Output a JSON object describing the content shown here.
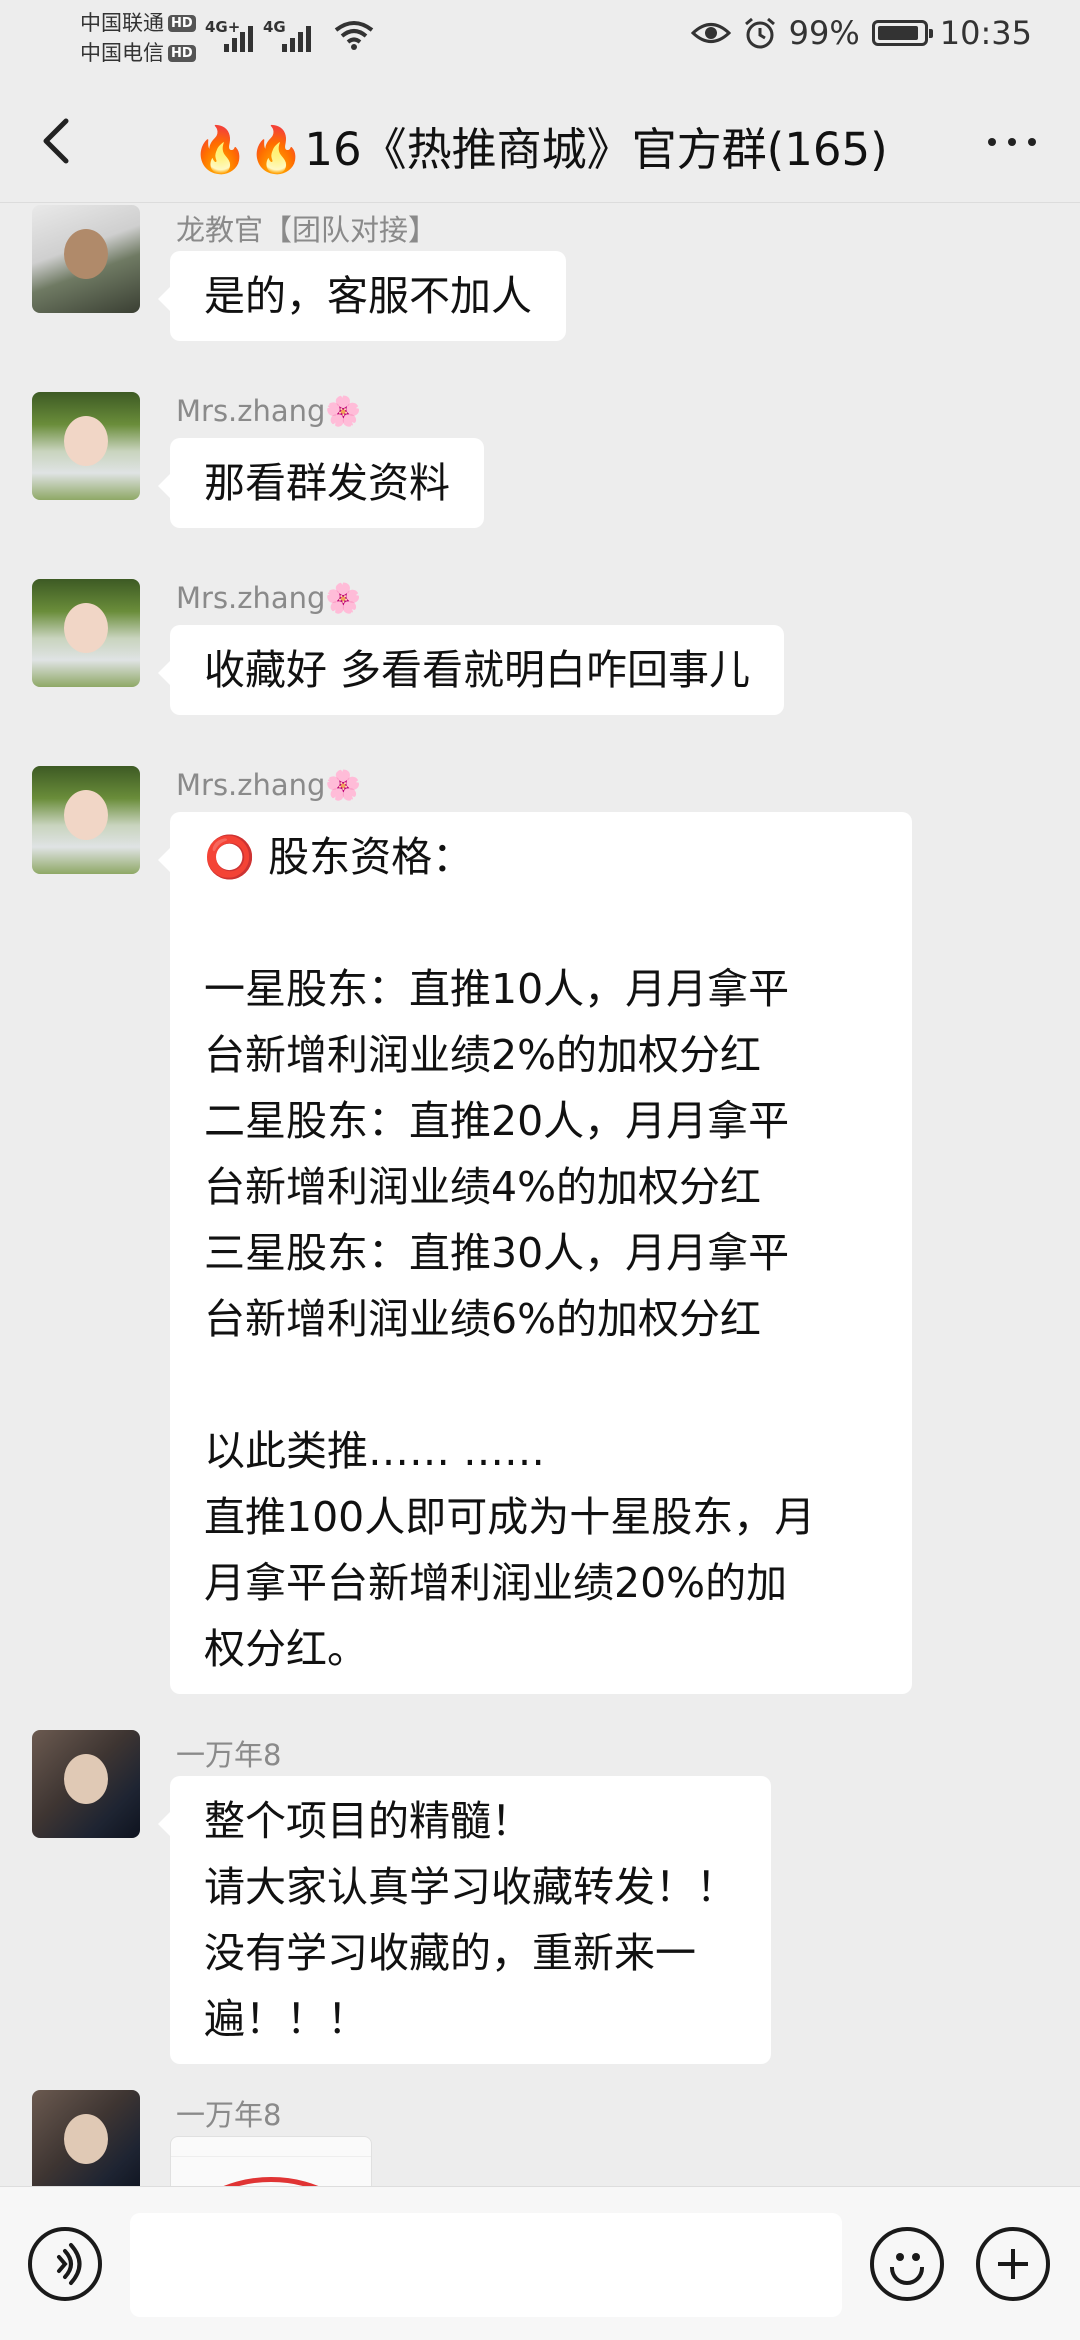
{
  "status_bar": {
    "carrier_1": "中国联通",
    "carrier_2": "中国电信",
    "hd_badge": "HD",
    "network_1": "4G+",
    "network_2": "4G",
    "battery_percent": "99%",
    "time": "10:35"
  },
  "header": {
    "title": "🔥🔥16《热推商城》官方群(165)"
  },
  "messages": [
    {
      "sender": "龙教官【团队对接】",
      "text": "是的，客服不加人"
    },
    {
      "sender": "Mrs.zhang🌸",
      "text": "那看群发资料"
    },
    {
      "sender": "Mrs.zhang🌸",
      "text": "收藏好 多看看就明白咋回事儿"
    },
    {
      "sender": "Mrs.zhang🌸",
      "text": "⭕ 股东资格：\n\n一星股东：直推10人，月月拿平\n台新增利润业绩2%的加权分红\n二星股东：直推20人，月月拿平\n台新增利润业绩4%的加权分红\n三星股东：直推30人，月月拿平\n台新增利润业绩6%的加权分红\n\n以此类推…… ……\n直推100人即可成为十星股东，月\n月拿平台新增利润业绩20%的加\n权分红。"
    },
    {
      "sender": "一万年8",
      "text": "整个项目的精髓！\n请大家认真学习收藏转发！！\n没有学习收藏的，重新来一\n遍！！！"
    },
    {
      "sender": "一万年8",
      "text": ""
    }
  ],
  "input": {
    "value": "",
    "placeholder": ""
  },
  "icons": {
    "back": "chevron-left-icon",
    "more": "more-dots-icon",
    "voice": "voice-icon",
    "emoji": "emoji-icon",
    "plus": "plus-icon"
  }
}
